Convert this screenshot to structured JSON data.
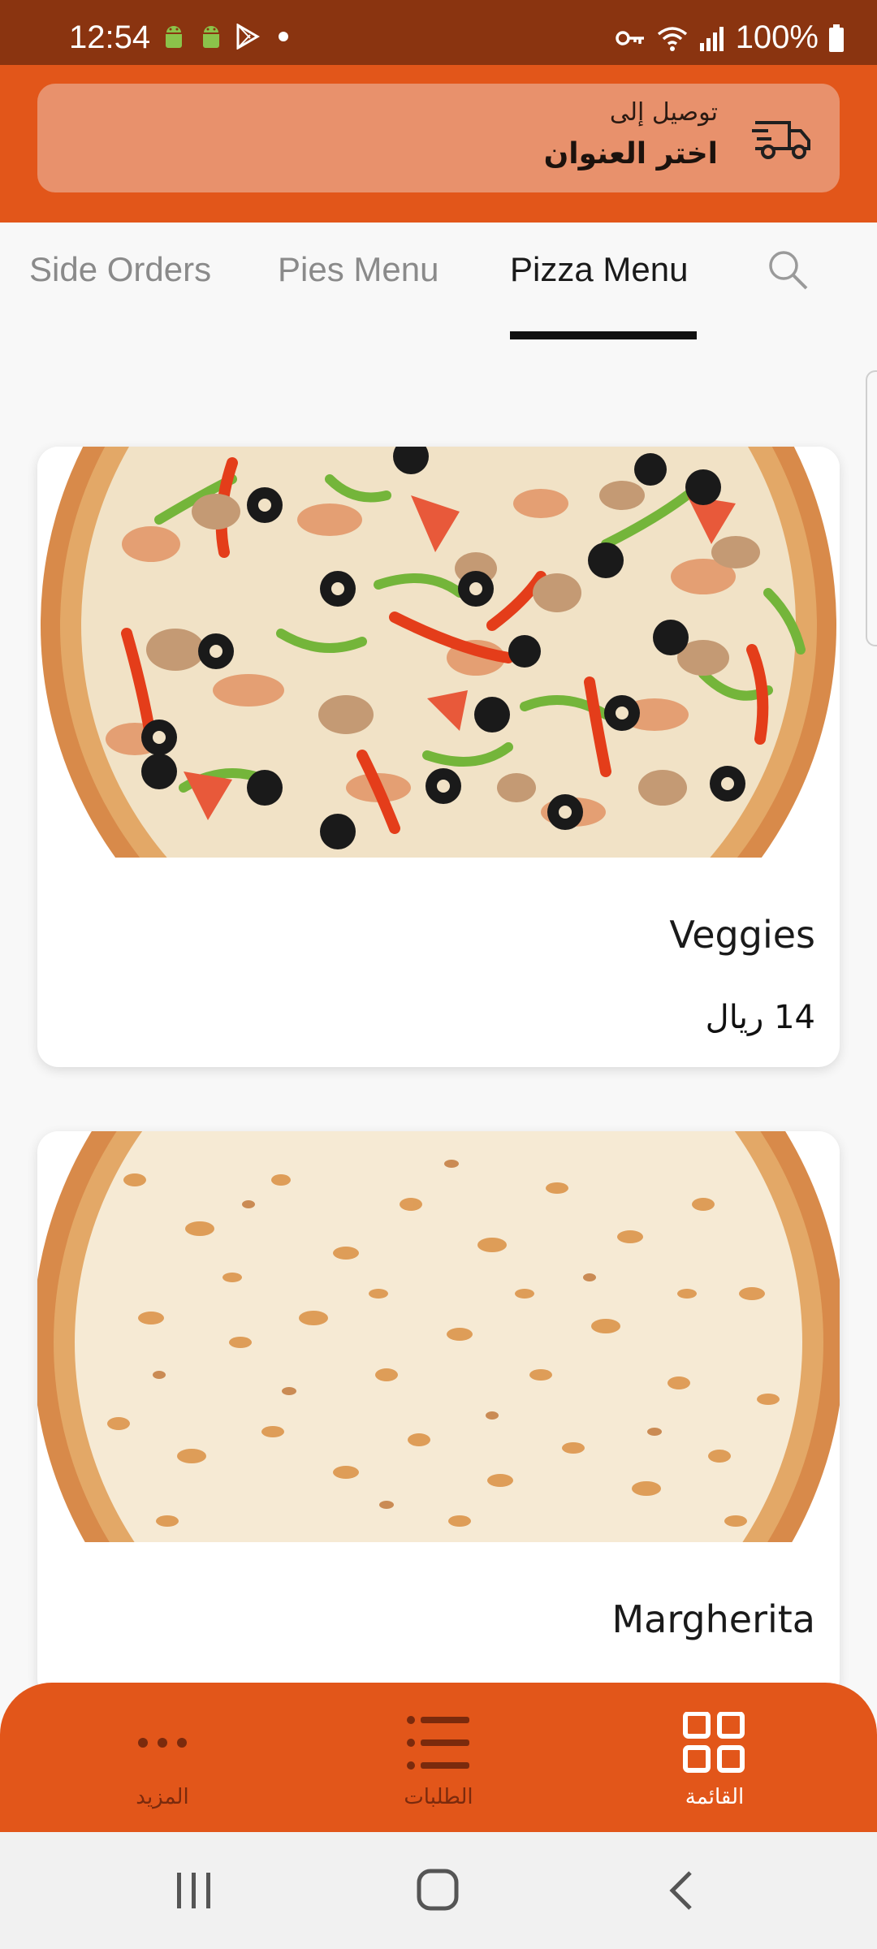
{
  "status_bar": {
    "time": "12:54",
    "battery": "100%",
    "icons": [
      "android-icon",
      "android-icon",
      "play-store-icon",
      "dot-icon",
      "vpn-key-icon",
      "wifi-icon",
      "signal-icon",
      "battery-icon"
    ]
  },
  "header": {
    "deliver_to": "توصيل إلى",
    "choose_address": "اختر العنوان",
    "icon": "delivery-truck-icon",
    "bg_color": "#e2561a",
    "card_color": "#e8916c"
  },
  "tabs": [
    {
      "label": "Side Orders",
      "active": false
    },
    {
      "label": "Pies Menu",
      "active": false
    },
    {
      "label": "Pizza Menu",
      "active": true
    }
  ],
  "menu_items": [
    {
      "name": "Veggies",
      "price": "14 ريال",
      "image": "veggie-pizza-image"
    },
    {
      "name": "Margherita",
      "image": "margherita-pizza-image"
    }
  ],
  "bottom_nav": [
    {
      "label": "المزيد",
      "icon": "more-dots-icon",
      "active": false
    },
    {
      "label": "الطلبات",
      "icon": "list-icon",
      "active": false
    },
    {
      "label": "القائمة",
      "icon": "grid-icon",
      "active": true
    }
  ],
  "system_nav": [
    "recents-icon",
    "home-icon",
    "back-icon"
  ]
}
